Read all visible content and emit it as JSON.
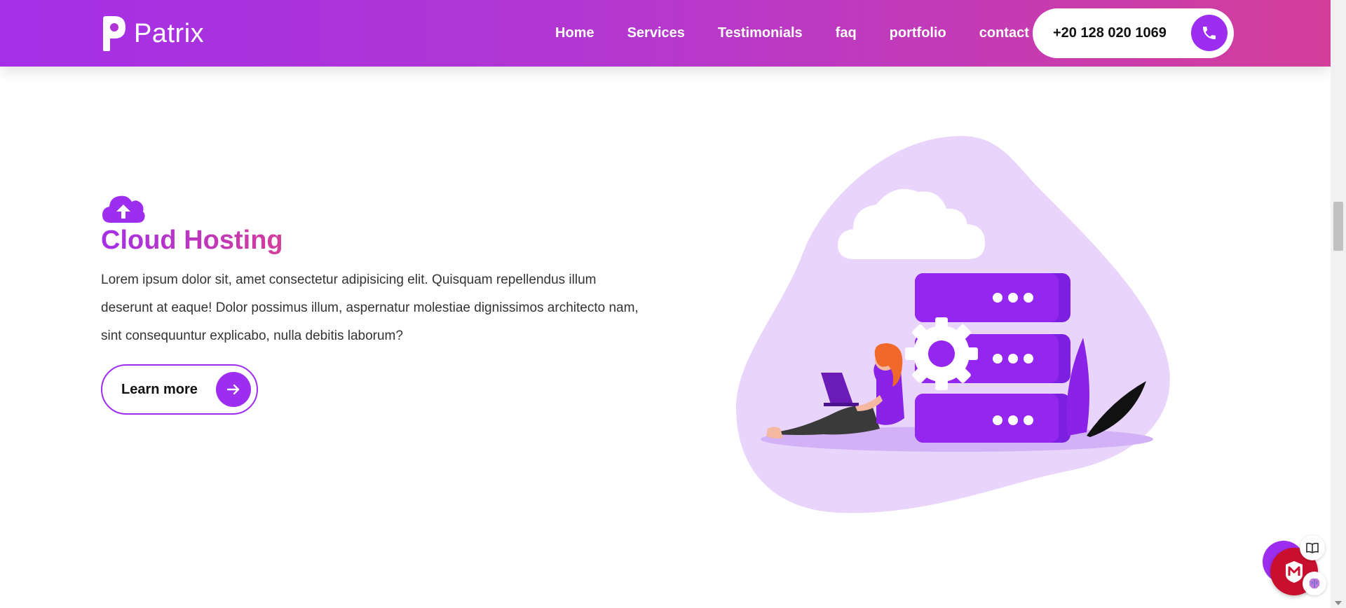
{
  "brand": {
    "name": "Patrix"
  },
  "nav": {
    "items": [
      "Home",
      "Services",
      "Testimonials",
      "faq",
      "portfolio",
      "contact"
    ],
    "phone": "+20 128 020 1069"
  },
  "feature": {
    "icon": "cloud-upload-icon",
    "title": "Cloud Hosting",
    "description": "Lorem ipsum dolor sit, amet consectetur adipisicing elit. Quisquam repellendus illum deserunt at eaque! Dolor possimus illum, aspernatur molestiae dignissimos architecto nam, sint consequuntur explicabo, nulla debitis laborum?",
    "button_label": "Learn more"
  },
  "colors": {
    "accent": "#9d2ef0",
    "gradient_start": "#a42fe6",
    "gradient_end": "#d33e9a",
    "blob": "#e9d5fb"
  }
}
